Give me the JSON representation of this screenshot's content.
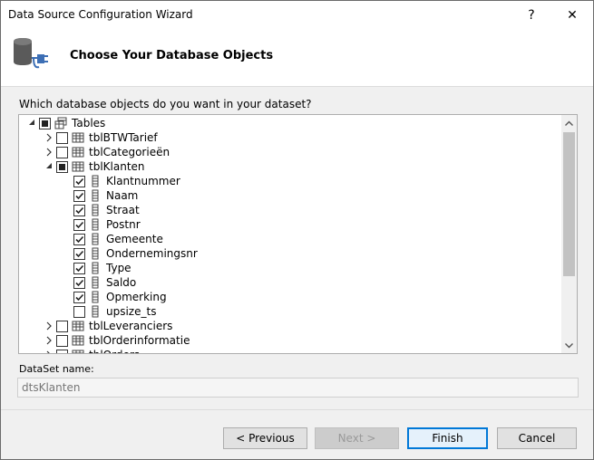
{
  "window": {
    "title": "Data Source Configuration Wizard",
    "help_glyph": "?",
    "close_glyph": "✕"
  },
  "header": {
    "icon": "database-connection-icon",
    "heading": "Choose Your Database Objects"
  },
  "question": "Which database objects do you want in your dataset?",
  "tree": {
    "root": {
      "label": "Tables",
      "state": "partial",
      "expanded": true
    },
    "tables": [
      {
        "label": "tblBTWTarief",
        "state": "unchecked",
        "expanded": false
      },
      {
        "label": "tblCategorieën",
        "state": "unchecked",
        "expanded": false
      },
      {
        "label": "tblKlanten",
        "state": "partial",
        "expanded": true,
        "columns": [
          {
            "label": "Klantnummer",
            "checked": true
          },
          {
            "label": "Naam",
            "checked": true
          },
          {
            "label": "Straat",
            "checked": true
          },
          {
            "label": "Postnr",
            "checked": true
          },
          {
            "label": "Gemeente",
            "checked": true
          },
          {
            "label": "Ondernemingsnr",
            "checked": true
          },
          {
            "label": "Type",
            "checked": true
          },
          {
            "label": "Saldo",
            "checked": true
          },
          {
            "label": "Opmerking",
            "checked": true
          },
          {
            "label": "upsize_ts",
            "checked": false
          }
        ]
      },
      {
        "label": "tblLeveranciers",
        "state": "unchecked",
        "expanded": false
      },
      {
        "label": "tblOrderinformatie",
        "state": "unchecked",
        "expanded": false
      },
      {
        "label": "tblOrders",
        "state": "unchecked",
        "expanded": false
      }
    ]
  },
  "dataset": {
    "label": "DataSet name:",
    "value": "dtsKlanten"
  },
  "buttons": {
    "previous": "< Previous",
    "next": "Next >",
    "finish": "Finish",
    "cancel": "Cancel"
  },
  "colors": {
    "accent": "#0078d7",
    "thumb": "#c2c2c2"
  }
}
